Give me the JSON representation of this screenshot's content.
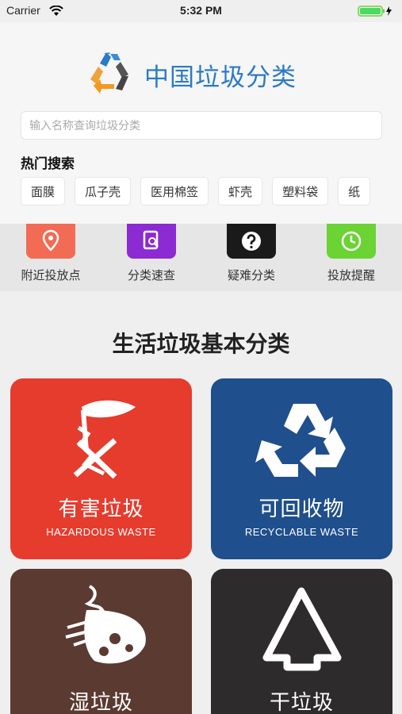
{
  "status_bar": {
    "carrier": "Carrier",
    "time": "5:32 PM"
  },
  "app": {
    "title": "中国垃圾分类"
  },
  "search": {
    "placeholder": "输入名称查询垃圾分类"
  },
  "hot_search": {
    "title": "热门搜索",
    "tags": [
      "面膜",
      "瓜子壳",
      "医用棉签",
      "虾壳",
      "塑料袋",
      "纸"
    ]
  },
  "quick_actions": [
    {
      "label": "附近投放点",
      "icon": "map-pin-icon",
      "color": "#f26b55"
    },
    {
      "label": "分类速查",
      "icon": "document-search-icon",
      "color": "#8b2bd1"
    },
    {
      "label": "疑难分类",
      "icon": "question-icon",
      "color": "#1a1a1a"
    },
    {
      "label": "投放提醒",
      "icon": "clock-icon",
      "color": "#6bd334"
    }
  ],
  "section": {
    "title": "生活垃圾基本分类"
  },
  "categories": [
    {
      "name": "有害垃圾",
      "sub": "HAZARDOUS WASTE",
      "color": "#e53c2e",
      "icon": "hazardous-icon"
    },
    {
      "name": "可回收物",
      "sub": "RECYCLABLE WASTE",
      "color": "#1f4f8c",
      "icon": "recycle-icon"
    },
    {
      "name": "湿垃圾",
      "sub": "",
      "color": "#5b3a31",
      "icon": "food-waste-icon"
    },
    {
      "name": "干垃圾",
      "sub": "",
      "color": "#2d2b2b",
      "icon": "dry-waste-icon"
    }
  ]
}
